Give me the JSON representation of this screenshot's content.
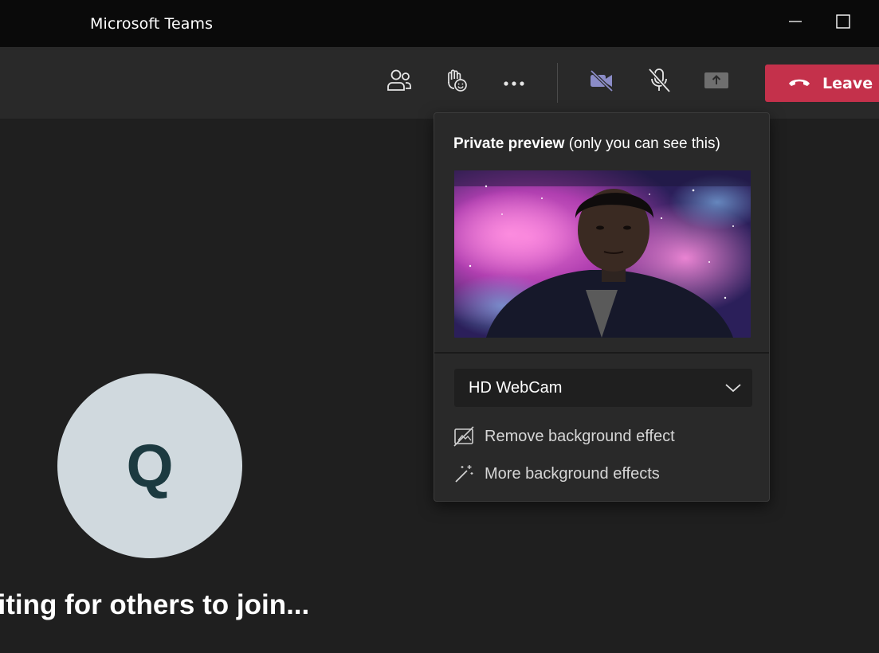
{
  "window": {
    "title": "Microsoft Teams"
  },
  "toolbar": {
    "participants_icon": "people-icon",
    "react_icon": "raise-hand-react-icon",
    "more_icon": "more-ellipsis-icon",
    "camera_icon": "camera-off-icon",
    "mic_icon": "mic-off-icon",
    "share_icon": "share-tray-icon",
    "leave_label": "Leave",
    "leave_color": "#c4314b",
    "camera_color": "#8b8cc7"
  },
  "stage": {
    "avatar_initial": "Q",
    "status_text": "aiting for others to join..."
  },
  "popover": {
    "heading_bold": "Private preview",
    "heading_rest": " (only you can see this)",
    "camera_device": "HD WebCam",
    "menu": [
      {
        "label": "Remove background effect",
        "icon": "no-background-icon"
      },
      {
        "label": "More background effects",
        "icon": "magic-wand-icon"
      }
    ]
  }
}
